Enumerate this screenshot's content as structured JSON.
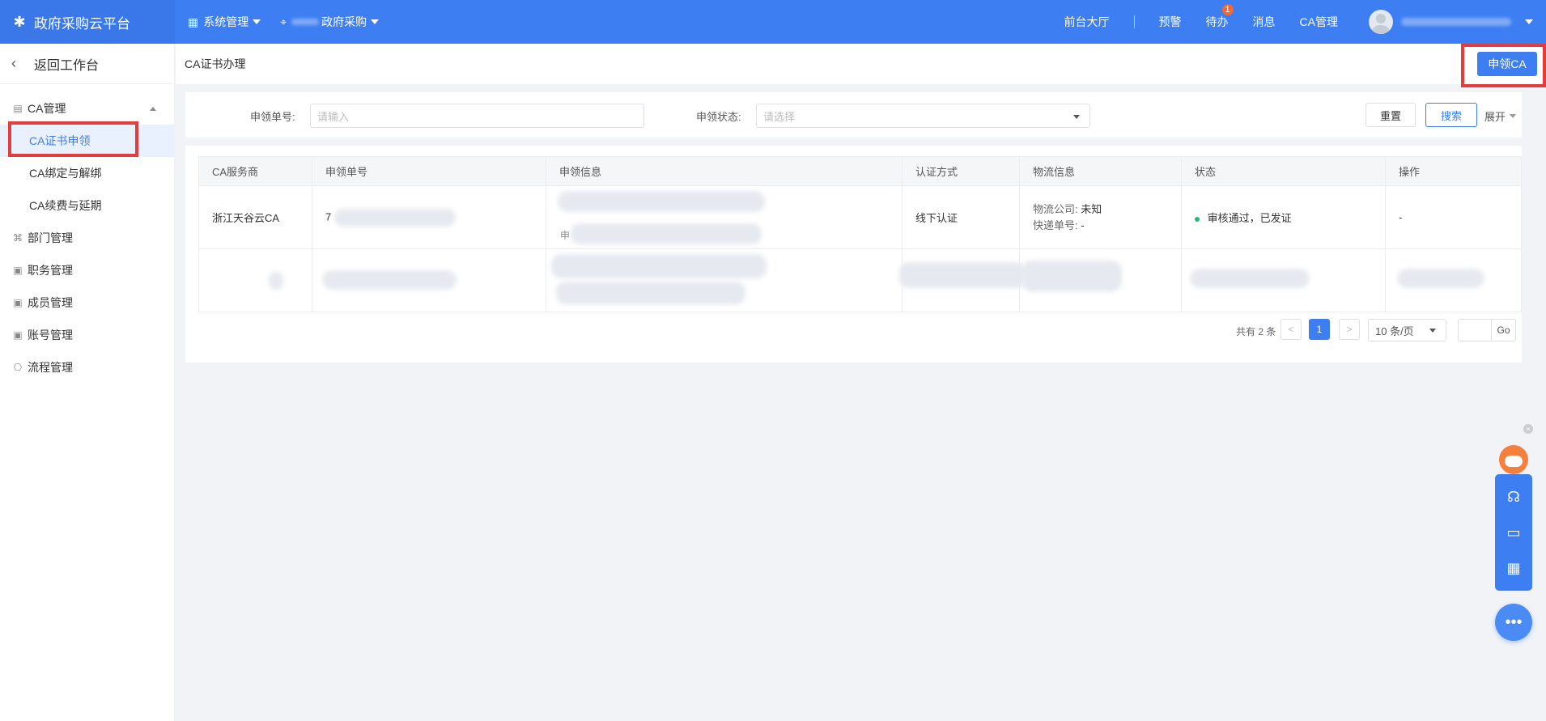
{
  "topbar": {
    "brand": "政府采购云平台",
    "menu_system": "系统管理",
    "menu_org": "政府采购",
    "links": {
      "lobby": "前台大厅",
      "alert": "预警",
      "todo": "待办",
      "todo_badge": "1",
      "message": "消息",
      "ca": "CA管理"
    }
  },
  "sidebar": {
    "back_label": "返回工作台",
    "group_ca": "CA管理",
    "sub_items": [
      "CA证书申领",
      "CA绑定与解绑",
      "CA续费与延期"
    ],
    "items": [
      "部门管理",
      "职务管理",
      "成员管理",
      "账号管理",
      "流程管理"
    ]
  },
  "page": {
    "title": "CA证书办理",
    "apply_button": "申领CA"
  },
  "filter": {
    "order_label": "申领单号:",
    "order_placeholder": "请输入",
    "status_label": "申领状态:",
    "status_placeholder": "请选择",
    "reset": "重置",
    "search": "搜索",
    "expand": "展开"
  },
  "table": {
    "headers": [
      "CA服务商",
      "申领单号",
      "申领信息",
      "认证方式",
      "物流信息",
      "状态",
      "操作"
    ],
    "row1": {
      "provider": "浙江天谷云CA",
      "order_prefix": "7",
      "info_prefix": "申",
      "auth": "线下认证",
      "logistics_company_label": "物流公司:",
      "logistics_company": "未知",
      "tracking_label": "快递单号:",
      "tracking": "-",
      "status": "审核通过，已发证",
      "action": "-"
    }
  },
  "pagination": {
    "total": "共有 2 条",
    "prev": "<",
    "page": "1",
    "next": ">",
    "size": "10 条/页",
    "go": "Go"
  },
  "colors": {
    "primary": "#3d7ef2",
    "highlight": "#e33d3d",
    "success": "#2bb673"
  }
}
